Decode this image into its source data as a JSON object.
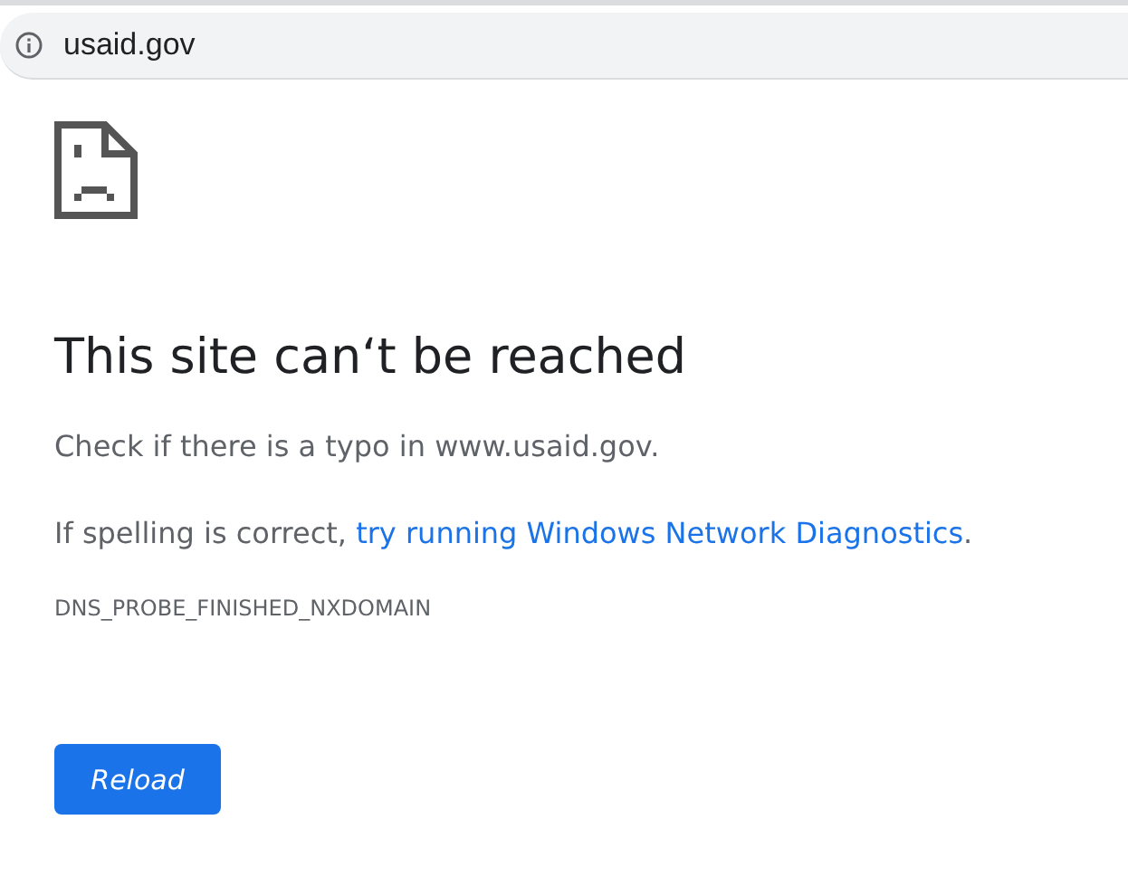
{
  "address_bar": {
    "url": "usaid.gov"
  },
  "error": {
    "title": "This site can‘t be reached",
    "message": "Check if there is a typo in www.usaid.gov.",
    "suggestion": {
      "text": "If spelling is correct, ",
      "link": "try running Windows Network Diagnostics",
      "end": "."
    },
    "code": "DNS_PROBE_FINISHED_NXDOMAIN"
  },
  "reload_button": {
    "label": "Reload"
  }
}
